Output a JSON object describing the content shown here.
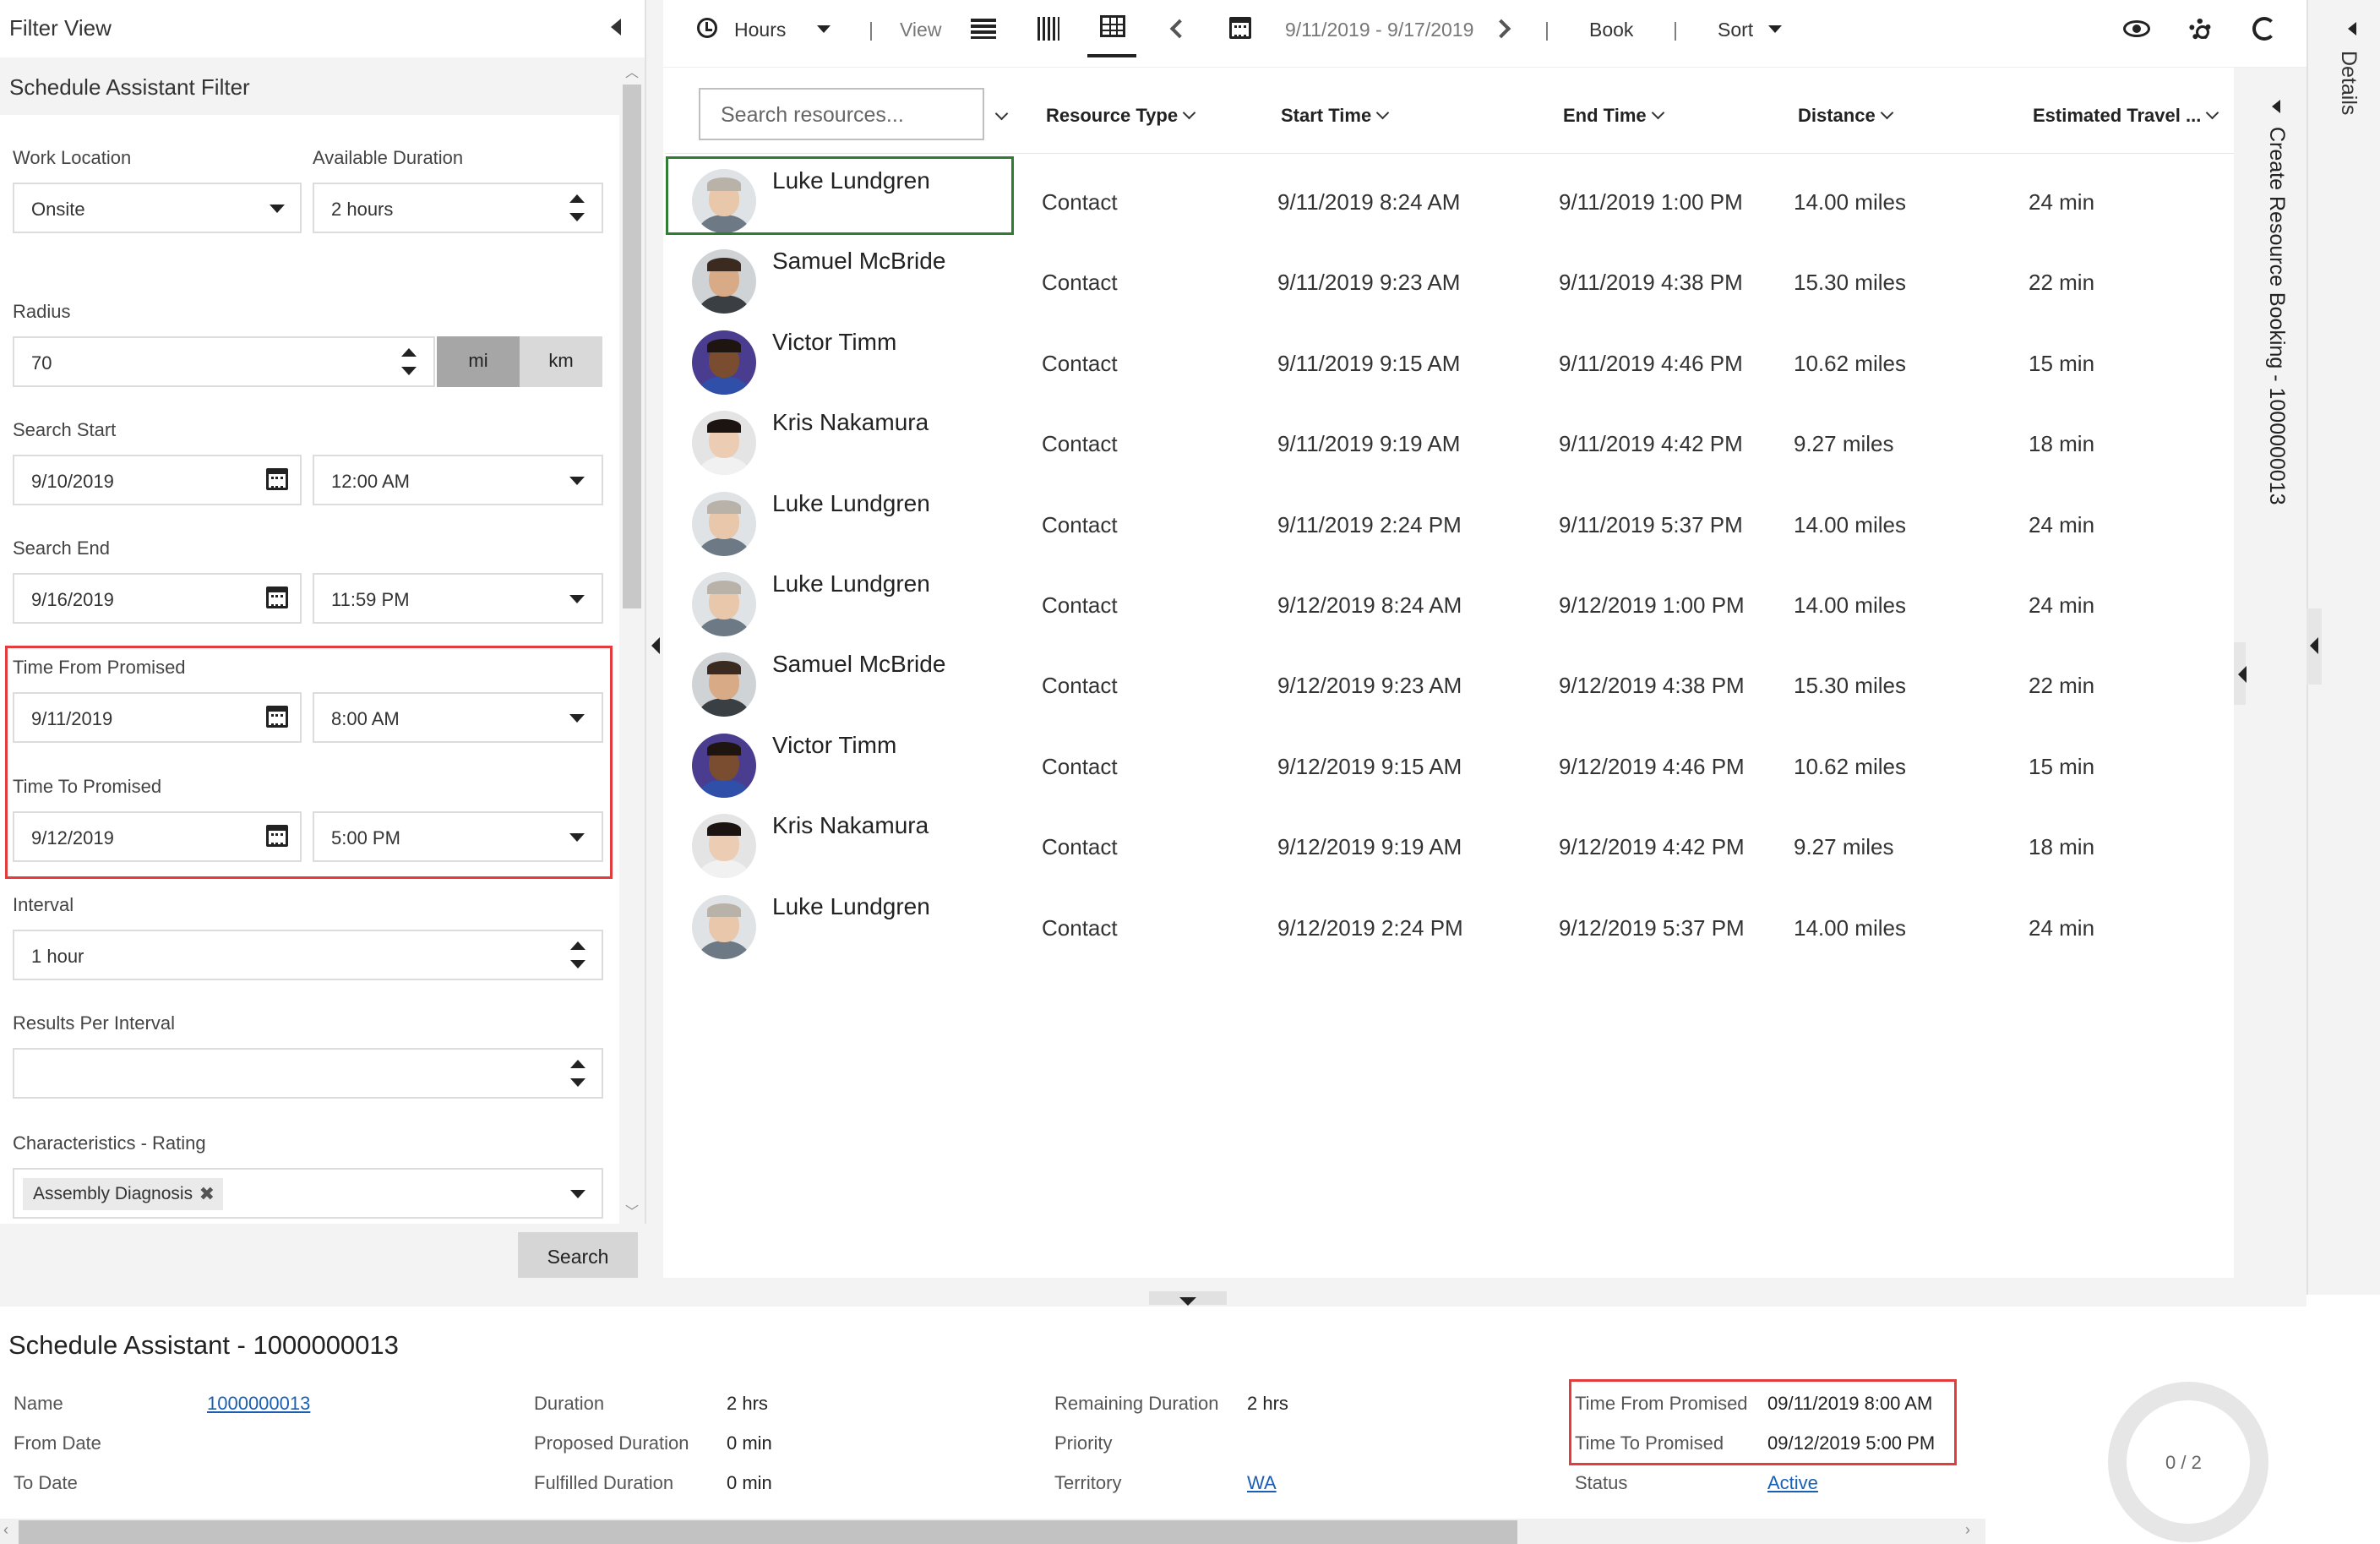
{
  "filter": {
    "title": "Filter View",
    "subtitle": "Schedule Assistant Filter",
    "work_location": {
      "label": "Work Location",
      "value": "Onsite"
    },
    "available_duration": {
      "label": "Available Duration",
      "value": "2 hours"
    },
    "radius": {
      "label": "Radius",
      "value": "70",
      "unit_mi": "mi",
      "unit_km": "km",
      "selected_unit": "mi"
    },
    "search_start": {
      "label": "Search Start",
      "date": "9/10/2019",
      "time": "12:00 AM"
    },
    "search_end": {
      "label": "Search End",
      "date": "9/16/2019",
      "time": "11:59 PM"
    },
    "time_from_promised": {
      "label": "Time From Promised",
      "date": "9/11/2019",
      "time": "8:00 AM"
    },
    "time_to_promised": {
      "label": "Time To Promised",
      "date": "9/12/2019",
      "time": "5:00 PM"
    },
    "interval": {
      "label": "Interval",
      "value": "1 hour"
    },
    "results_per_interval": {
      "label": "Results Per Interval",
      "value": ""
    },
    "characteristics": {
      "label": "Characteristics - Rating",
      "tag": "Assembly Diagnosis",
      "tag_remove": "✖"
    },
    "search_button": "Search"
  },
  "toolbar": {
    "hours": "Hours",
    "view": "View",
    "date_range": "9/11/2019 - 9/17/2019",
    "book": "Book",
    "sort": "Sort",
    "sep": "|"
  },
  "grid": {
    "search_placeholder": "Search resources...",
    "columns": [
      "Resource Type",
      "Start Time",
      "End Time",
      "Distance",
      "Estimated Travel ..."
    ],
    "rows": [
      {
        "name": "Luke Lundgren",
        "type": "Contact",
        "start": "9/11/2019 8:24 AM",
        "end": "9/11/2019 1:00 PM",
        "distance": "14.00 miles",
        "travel": "24 min",
        "avatar": "luke"
      },
      {
        "name": "Samuel McBride",
        "type": "Contact",
        "start": "9/11/2019 9:23 AM",
        "end": "9/11/2019 4:38 PM",
        "distance": "15.30 miles",
        "travel": "22 min",
        "avatar": "samuel"
      },
      {
        "name": "Victor Timm",
        "type": "Contact",
        "start": "9/11/2019 9:15 AM",
        "end": "9/11/2019 4:46 PM",
        "distance": "10.62 miles",
        "travel": "15 min",
        "avatar": "victor"
      },
      {
        "name": "Kris Nakamura",
        "type": "Contact",
        "start": "9/11/2019 9:19 AM",
        "end": "9/11/2019 4:42 PM",
        "distance": "9.27 miles",
        "travel": "18 min",
        "avatar": "kris"
      },
      {
        "name": "Luke Lundgren",
        "type": "Contact",
        "start": "9/11/2019 2:24 PM",
        "end": "9/11/2019 5:37 PM",
        "distance": "14.00 miles",
        "travel": "24 min",
        "avatar": "luke"
      },
      {
        "name": "Luke Lundgren",
        "type": "Contact",
        "start": "9/12/2019 8:24 AM",
        "end": "9/12/2019 1:00 PM",
        "distance": "14.00 miles",
        "travel": "24 min",
        "avatar": "luke"
      },
      {
        "name": "Samuel McBride",
        "type": "Contact",
        "start": "9/12/2019 9:23 AM",
        "end": "9/12/2019 4:38 PM",
        "distance": "15.30 miles",
        "travel": "22 min",
        "avatar": "samuel"
      },
      {
        "name": "Victor Timm",
        "type": "Contact",
        "start": "9/12/2019 9:15 AM",
        "end": "9/12/2019 4:46 PM",
        "distance": "10.62 miles",
        "travel": "15 min",
        "avatar": "victor"
      },
      {
        "name": "Kris Nakamura",
        "type": "Contact",
        "start": "9/12/2019 9:19 AM",
        "end": "9/12/2019 4:42 PM",
        "distance": "9.27 miles",
        "travel": "18 min",
        "avatar": "kris"
      },
      {
        "name": "Luke Lundgren",
        "type": "Contact",
        "start": "9/12/2019 2:24 PM",
        "end": "9/12/2019 5:37 PM",
        "distance": "14.00 miles",
        "travel": "24 min",
        "avatar": "luke"
      }
    ],
    "right_panel_title": "Create Resource Booking - 1000000013"
  },
  "details_label": "Details",
  "bottom": {
    "title": "Schedule Assistant - 1000000013",
    "name_label": "Name",
    "name_value": "1000000013",
    "from_date_label": "From Date",
    "to_date_label": "To Date",
    "duration_label": "Duration",
    "duration_value": "2 hrs",
    "proposed_label": "Proposed Duration",
    "proposed_value": "0 min",
    "fulfilled_label": "Fulfilled Duration",
    "fulfilled_value": "0 min",
    "remaining_label": "Remaining Duration",
    "remaining_value": "2 hrs",
    "priority_label": "Priority",
    "territory_label": "Territory",
    "territory_value": "WA",
    "tfp_label": "Time From Promised",
    "tfp_value": "09/11/2019 8:00 AM",
    "ttp_label": "Time To Promised",
    "ttp_value": "09/12/2019 5:00 PM",
    "status_label": "Status",
    "status_value": "Active",
    "progress": "0 / 2"
  },
  "colors": {
    "accent_red": "#e23c3c",
    "selection_green": "#2e7d32",
    "link_blue": "#1a5fb4"
  }
}
